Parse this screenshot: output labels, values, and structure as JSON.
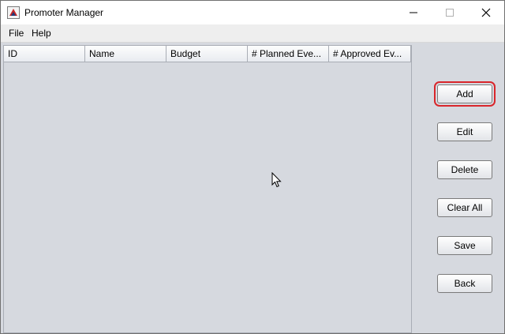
{
  "window": {
    "title": "Promoter Manager",
    "app_icon": "java-app-icon"
  },
  "window_controls": {
    "minimize": "minimize-icon",
    "maximize": "maximize-icon",
    "close": "close-icon"
  },
  "menu": {
    "items": [
      "File",
      "Help"
    ]
  },
  "table": {
    "columns": [
      "ID",
      "Name",
      "Budget",
      "# Planned Eve...",
      "#  Approved Ev..."
    ],
    "rows": []
  },
  "buttons": {
    "add": "Add",
    "edit": "Edit",
    "delete": "Delete",
    "clear_all": "Clear All",
    "save": "Save",
    "back": "Back"
  },
  "colors": {
    "focus_highlight": "#d9262b",
    "panel_bg": "#d6d9df"
  }
}
